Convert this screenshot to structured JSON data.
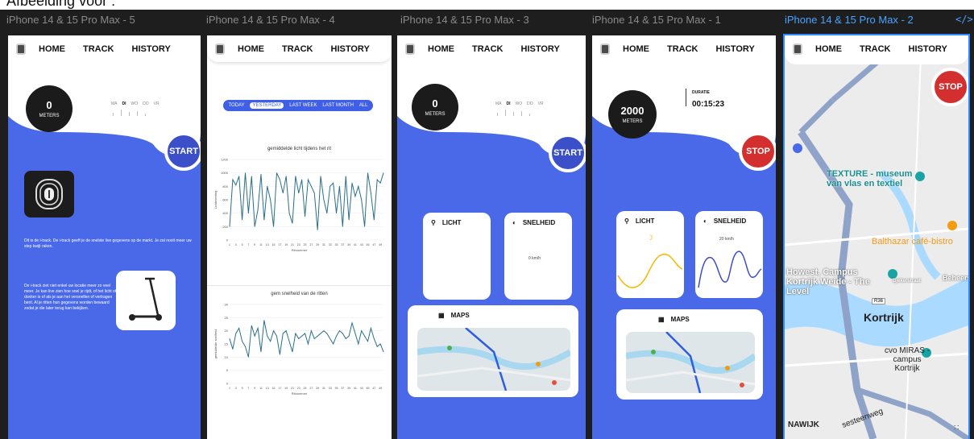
{
  "caption": "Afbeelding voor :",
  "frames": [
    {
      "label": "iPhone 14 & 15 Pro Max - 5"
    },
    {
      "label": "iPhone 14 & 15 Pro Max - 4"
    },
    {
      "label": "iPhone 14 & 15 Pro Max - 3"
    },
    {
      "label": "iPhone 14 & 15 Pro Max - 1"
    },
    {
      "label": "iPhone 14 & 15 Pro Max - 2"
    }
  ],
  "nav": {
    "home": "HOME",
    "track": "TRACK",
    "history": "HISTORY"
  },
  "meters": {
    "zero": "0",
    "two_thousand": "2000",
    "unit": "METERS"
  },
  "days": [
    "MA",
    "DI",
    "WO",
    "DO",
    "VR"
  ],
  "buttons": {
    "start": "START",
    "stop": "STOP"
  },
  "intro": {
    "p1": "Dit is de i-track. De i-track geeft je de snelste live gegevens op de markt. Je zal nooit meer uw step kwijt raken.",
    "p2": "De i-track ziet niet enkel uw locatie meer zo veel meer. Je kan live zien hoe snel je rijdt, of het licht of donker is of als je aan het versnellen of vertragen bent. Al je ritten hun gegevens worden bewaard zodat je die later terug kan bekijken."
  },
  "history": {
    "filters": [
      "TODAY",
      "YESTERDAY",
      "LAST WEEK",
      "LAST MONTH",
      "ALL"
    ],
    "selected_filter": "YESTERDAY",
    "chart1_title": "gemiddelde licht tijdens het rit",
    "chart1_ylabel": "Lichtmeeting",
    "chart1_xlabel": "Ritnummer",
    "chart2_title": "gem snelheid van de ritten",
    "chart2_ylabel": "gemiddelde snelheid",
    "chart2_xlabel": "Ritnummer"
  },
  "cards": {
    "light": "LICHT",
    "speed": "SNELHEID",
    "maps": "MAPS"
  },
  "speed_zero": "0 km/h",
  "speed_twenty": "20 km/h",
  "duration": {
    "label": "DURATIE",
    "value": "00:15:23"
  },
  "map": {
    "museum": "TEXTURE - museum van vlas en textiel",
    "cafe": "Balthazar café-bistro",
    "campus_howest": "Howest, Campus Kortrijk Weide - The Level",
    "city": "Kortrijk",
    "cvo": "cvo MIRAS - campus Kortrijk",
    "street1": "Beheerstraat",
    "street2": "Bjekerstraat",
    "road": "R36",
    "district": "NAWIJK",
    "street3": "sesteenweg"
  },
  "colors": {
    "blue": "#4a69e8",
    "dark_blue": "#3b4fc8",
    "red": "#d32f2f",
    "chart_line": "#2a6f8a",
    "yellow": "#f5b800"
  },
  "chart_data": [
    {
      "type": "line",
      "title": "gemiddelde licht tijdens het rit",
      "xlabel": "Ritnummer",
      "ylabel": "Lichtmeeting",
      "ylim": [
        0,
        1200
      ],
      "x": [
        1,
        2,
        3,
        4,
        5,
        6,
        7,
        8,
        9,
        10,
        11,
        12,
        13,
        14,
        15,
        16,
        17,
        18,
        19,
        20,
        21,
        22,
        23,
        24,
        25,
        26,
        27,
        28,
        29,
        30,
        31,
        32,
        33,
        34,
        35,
        36,
        37,
        38,
        39,
        40,
        41,
        42,
        43,
        44,
        45,
        46,
        47,
        48,
        49,
        50
      ],
      "values": [
        200,
        900,
        820,
        950,
        300,
        1000,
        400,
        950,
        200,
        450,
        980,
        300,
        800,
        600,
        200,
        1000,
        900,
        700,
        950,
        400,
        250,
        950,
        700,
        900,
        350,
        900,
        800,
        700,
        150,
        950,
        600,
        400,
        800,
        850,
        400,
        800,
        200,
        950,
        300,
        850,
        650,
        800,
        600,
        200,
        1000,
        700,
        300,
        900,
        850,
        1000
      ]
    },
    {
      "type": "line",
      "title": "gem snelheid van de ritten",
      "xlabel": "Ritnummer",
      "ylabel": "gemiddelde snelheid",
      "ylim": [
        0,
        30
      ],
      "x": [
        1,
        2,
        3,
        4,
        5,
        6,
        7,
        8,
        9,
        10,
        11,
        12,
        13,
        14,
        15,
        16,
        17,
        18,
        19,
        20,
        21,
        22,
        23,
        24,
        25,
        26,
        27,
        28,
        29,
        30,
        31,
        32,
        33,
        34,
        35,
        36,
        37,
        38,
        39,
        40,
        41,
        42,
        43,
        44,
        45,
        46,
        47,
        48,
        49,
        50
      ],
      "values": [
        17,
        13,
        19,
        21,
        16,
        14,
        10,
        22,
        18,
        21,
        12,
        24,
        18,
        16,
        20,
        18,
        11,
        19,
        20,
        16,
        12,
        19,
        17,
        18,
        19,
        15,
        20,
        17,
        18,
        19,
        20,
        19,
        17,
        15,
        18,
        20,
        19,
        17,
        18,
        23,
        19,
        15,
        20,
        18,
        16,
        21,
        17,
        14,
        15,
        12
      ]
    }
  ]
}
